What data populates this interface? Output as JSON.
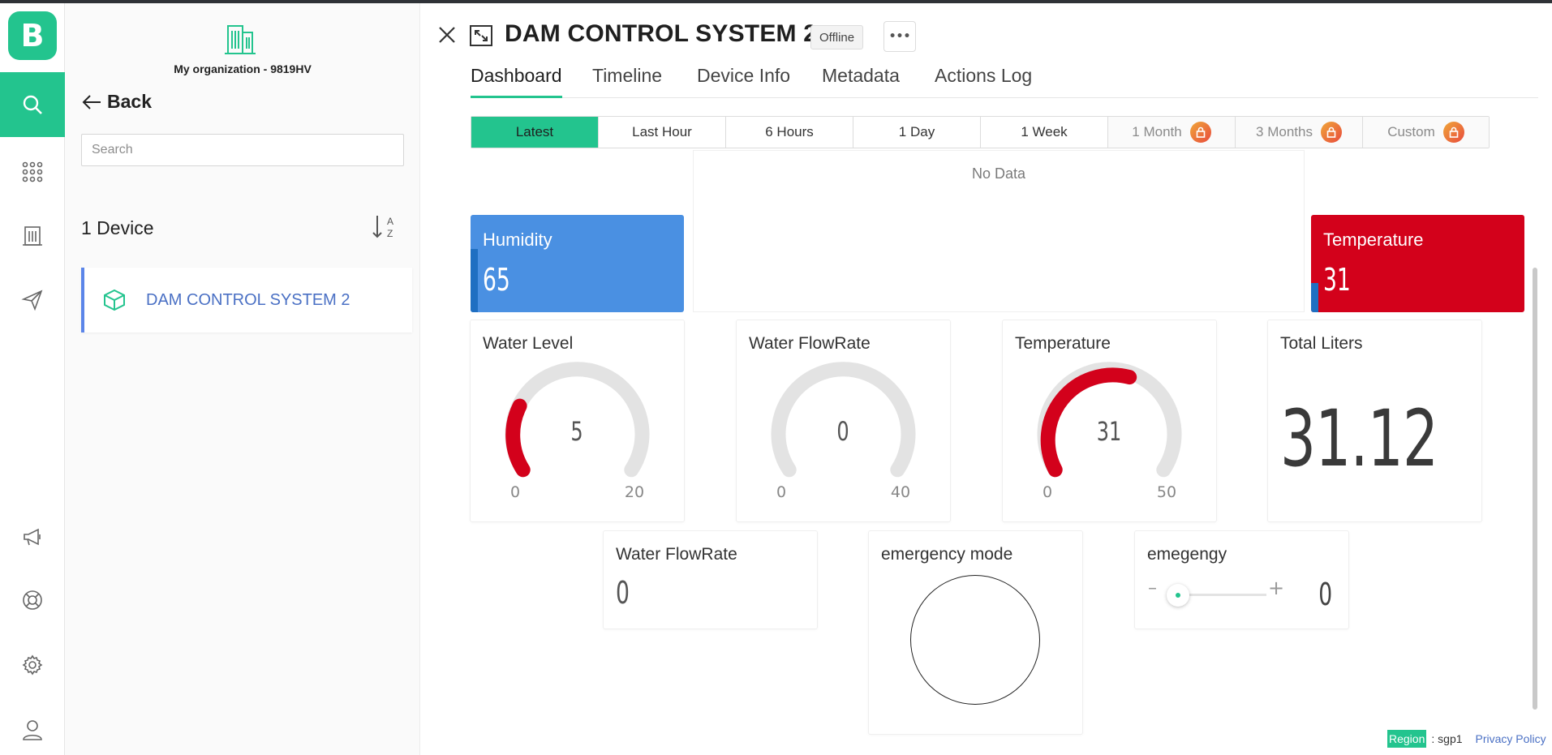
{
  "app": {
    "logo_letter": "B",
    "accent": "#23c48e"
  },
  "sidebar": {
    "org_name": "My organization - 9819HV",
    "back_label": "Back",
    "search_placeholder": "Search",
    "device_count": "1 Device",
    "sort_label_a": "A",
    "sort_label_z": "Z",
    "devices": [
      {
        "name": "DAM CONTROL SYSTEM 2"
      }
    ]
  },
  "header": {
    "title": "DAM CONTROL SYSTEM 2",
    "status": "Offline",
    "more_label": "•••"
  },
  "tabs": [
    "Dashboard",
    "Timeline",
    "Device Info",
    "Metadata",
    "Actions Log"
  ],
  "ranges": [
    "Latest",
    "Last Hour",
    "6 Hours",
    "1 Day",
    "1 Week",
    "1 Month",
    "3 Months",
    "Custom"
  ],
  "chart": {
    "empty_text": "No Data"
  },
  "widgets": {
    "humidity": {
      "label": "Humidity",
      "value": "65",
      "color": "#4a90e2"
    },
    "temperature_value": {
      "label": "Temperature",
      "value": "31",
      "color": "#d3011b"
    },
    "water_level": {
      "label": "Water Level",
      "value": "5",
      "min": "0",
      "max": "20"
    },
    "water_flowrate_gauge": {
      "label": "Water FlowRate",
      "value": "0",
      "min": "0",
      "max": "40"
    },
    "temperature_gauge": {
      "label": "Temperature",
      "value": "31",
      "min": "0",
      "max": "50"
    },
    "total_liters": {
      "label": "Total Liters",
      "value": "31.12"
    },
    "water_flowrate_value": {
      "label": "Water FlowRate",
      "value": "0"
    },
    "emergency_mode": {
      "label": "emergency mode"
    },
    "emegengy": {
      "label": "emegengy",
      "value": "0",
      "minus": "–",
      "plus": "+"
    }
  },
  "footer": {
    "region_label": "Region",
    "region_value": ": sgp1",
    "privacy": "Privacy Policy"
  }
}
